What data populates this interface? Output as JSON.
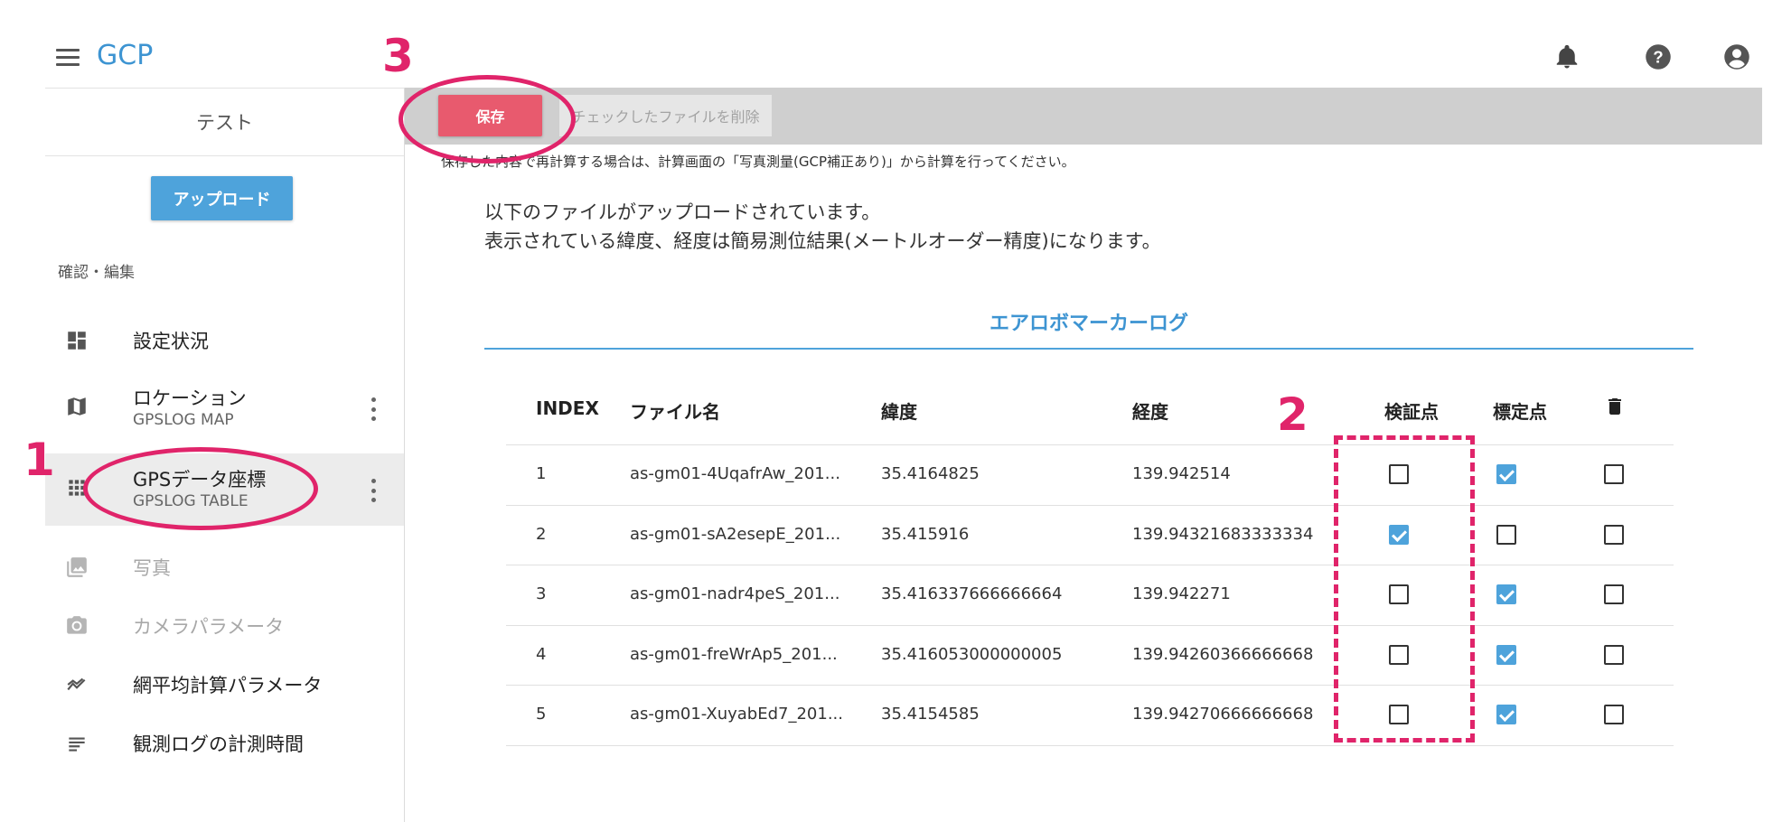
{
  "app": {
    "title": "GCP"
  },
  "header_icons": [
    "bell-icon",
    "help-icon",
    "account-icon"
  ],
  "sidebar": {
    "project": "テスト",
    "upload_label": "アップロード",
    "section_title": "確認・編集",
    "items": [
      {
        "label": "設定状況",
        "sub": "",
        "icon": "dashboard-icon",
        "disabled": false
      },
      {
        "label": "ロケーション",
        "sub": "GPSLOG MAP",
        "icon": "map-icon",
        "disabled": false
      },
      {
        "label": "GPSデータ座標",
        "sub": "GPSLOG TABLE",
        "icon": "grid-icon",
        "disabled": false,
        "active": true
      },
      {
        "label": "写真",
        "sub": "",
        "icon": "photo-icon",
        "disabled": true
      },
      {
        "label": "カメラパラメータ",
        "sub": "",
        "icon": "camera-icon",
        "disabled": true
      },
      {
        "label": "網平均計算パラメータ",
        "sub": "",
        "icon": "trend-icon",
        "disabled": false
      },
      {
        "label": "観測ログの計測時間",
        "sub": "",
        "icon": "notes-icon",
        "disabled": false
      }
    ]
  },
  "toolbar": {
    "save_label": "保存",
    "delete_label": "チェックしたファイルを削除"
  },
  "main": {
    "note": "保存した内容で再計算する場合は、計算画面の「写真測量(GCP補正あり)」から計算を行ってください。",
    "intro_line1": "以下のファイルがアップロードされています。",
    "intro_line2": "表示されている緯度、経度は簡易測位結果(メートルオーダー精度)になります。",
    "log_title": "エアロボマーカーログ"
  },
  "table": {
    "headers": {
      "index": "INDEX",
      "file": "ファイル名",
      "lat": "緯度",
      "lon": "経度",
      "verify": "検証点",
      "calib": "標定点",
      "delete_icon": "trash-icon"
    },
    "rows": [
      {
        "index": "1",
        "file": "as-gm01-4UqafrAw_201...",
        "lat": "35.4164825",
        "lon": "139.942514",
        "verify": false,
        "calib": true,
        "delete": false
      },
      {
        "index": "2",
        "file": "as-gm01-sA2esepE_201...",
        "lat": "35.415916",
        "lon": "139.94321683333334",
        "verify": true,
        "calib": false,
        "delete": false
      },
      {
        "index": "3",
        "file": "as-gm01-nadr4peS_201...",
        "lat": "35.416337666666664",
        "lon": "139.942271",
        "verify": false,
        "calib": true,
        "delete": false
      },
      {
        "index": "4",
        "file": "as-gm01-freWrAp5_201...",
        "lat": "35.416053000000005",
        "lon": "139.94260366666668",
        "verify": false,
        "calib": true,
        "delete": false
      },
      {
        "index": "5",
        "file": "as-gm01-XuyabEd7_201...",
        "lat": "35.4154585",
        "lon": "139.94270666666668",
        "verify": false,
        "calib": true,
        "delete": false
      }
    ]
  },
  "annotations": {
    "n1": "1",
    "n2": "2",
    "n3": "3"
  },
  "colors": {
    "accent": "#3d94d2",
    "save": "#e85a6e",
    "annotation": "#e0246a"
  }
}
